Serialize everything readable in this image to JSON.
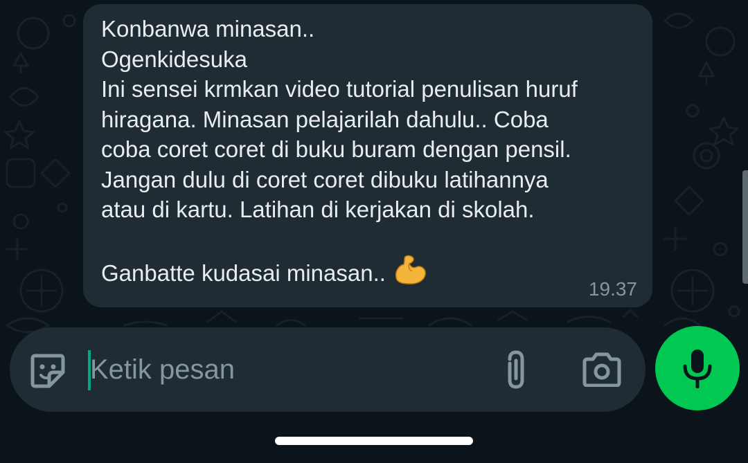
{
  "message": {
    "lines": [
      "Konbanwa minasan..",
      "Ogenkidesuka",
      "Ini sensei krmkan video tutorial penulisan huruf",
      "hiragana. Minasan pelajarilah dahulu.. Coba",
      "coba coret coret di buku buram dengan pensil.",
      "Jangan dulu di coret coret dibuku latihannya",
      "atau di kartu. Latihan di kerjakan di skolah.",
      "",
      "Ganbatte kudasai minasan.."
    ],
    "emoji": "flexed-biceps-emoji",
    "time": "19.37"
  },
  "composer": {
    "placeholder": "Ketik pesan",
    "value": "",
    "icons": {
      "sticker": "sticker-icon",
      "attach": "paperclip-icon",
      "camera": "camera-icon",
      "mic": "microphone-icon"
    }
  },
  "colors": {
    "background": "#0b141a",
    "bubble": "#202c33",
    "input_bar": "#1f2c34",
    "accent": "#00a884",
    "mic_button": "#00c853",
    "text": "#e9edef",
    "muted": "#8696a0"
  }
}
